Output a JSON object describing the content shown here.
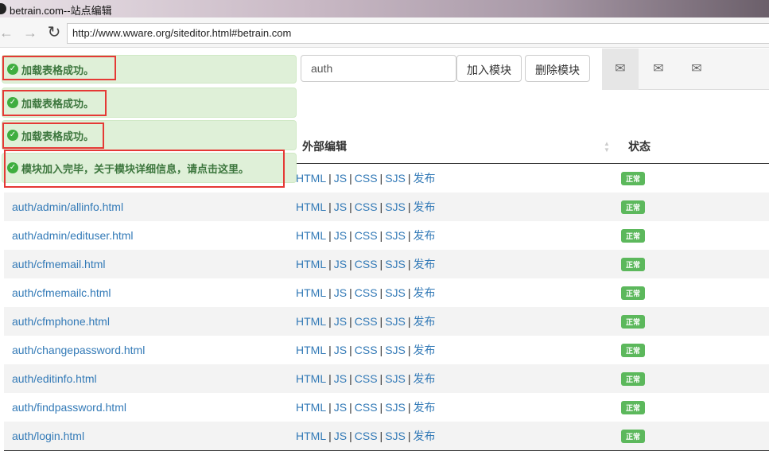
{
  "window": {
    "title": "betrain.com--站点编辑"
  },
  "browser": {
    "url": "http://www.wware.org/siteditor.html#betrain.com"
  },
  "toolbar": {
    "search_value": "auth",
    "add_label": "加入模块",
    "delete_label": "删除模块"
  },
  "tabs": [
    {
      "icon": "envelope-icon"
    },
    {
      "icon": "envelope-icon"
    },
    {
      "icon": "envelope-icon"
    }
  ],
  "toasts": [
    "加载表格成功。",
    "加载表格成功。",
    "加载表格成功。",
    "模块加入完毕，关于模块详细信息，请点击这里。"
  ],
  "table": {
    "headers": {
      "external_edit": "外部编辑",
      "status": "状态"
    },
    "link_labels": [
      "HTML",
      "JS",
      "CSS",
      "SJS",
      "发布"
    ],
    "status_label": "正常",
    "rows": [
      "",
      "auth/admin/allinfo.html",
      "auth/admin/edituser.html",
      "auth/cfmemail.html",
      "auth/cfmemailc.html",
      "auth/cfmphone.html",
      "auth/changepassword.html",
      "auth/editinfo.html",
      "auth/findpassword.html",
      "auth/login.html"
    ]
  },
  "colors": {
    "toast_bg": "#dff0d8",
    "toast_text": "#3c763d",
    "link": "#337ab7",
    "badge": "#5cb85c",
    "highlight": "#e53935"
  }
}
